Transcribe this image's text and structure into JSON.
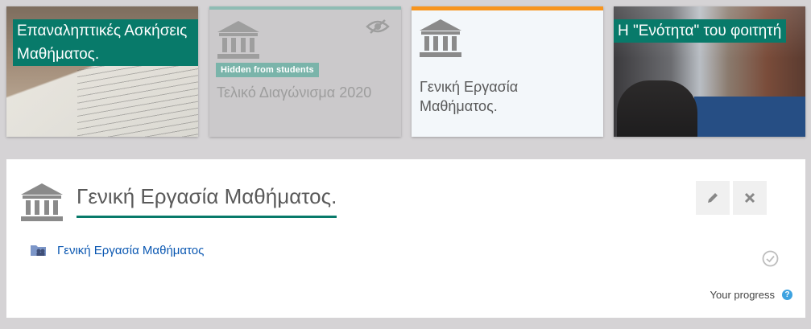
{
  "tiles": [
    {
      "label": "Επαναληπτικές Ασκήσεις Μαθήματος."
    },
    {
      "badge": "Hidden from students",
      "title": "Τελικό Διαγώνισμα 2020"
    },
    {
      "title": "Γενική Εργασία Μαθήματος."
    },
    {
      "label": "Η \"Ενότητα\" του φοιτητή"
    }
  ],
  "section": {
    "title": "Γενική Εργασία Μαθήματος.",
    "activity_label": "Γενική Εργασία Μαθήματος",
    "progress_label": "Your progress",
    "help_symbol": "?"
  },
  "colors": {
    "accent": "#087a6a",
    "active_bar": "#f7941d",
    "link": "#0b58b2"
  }
}
